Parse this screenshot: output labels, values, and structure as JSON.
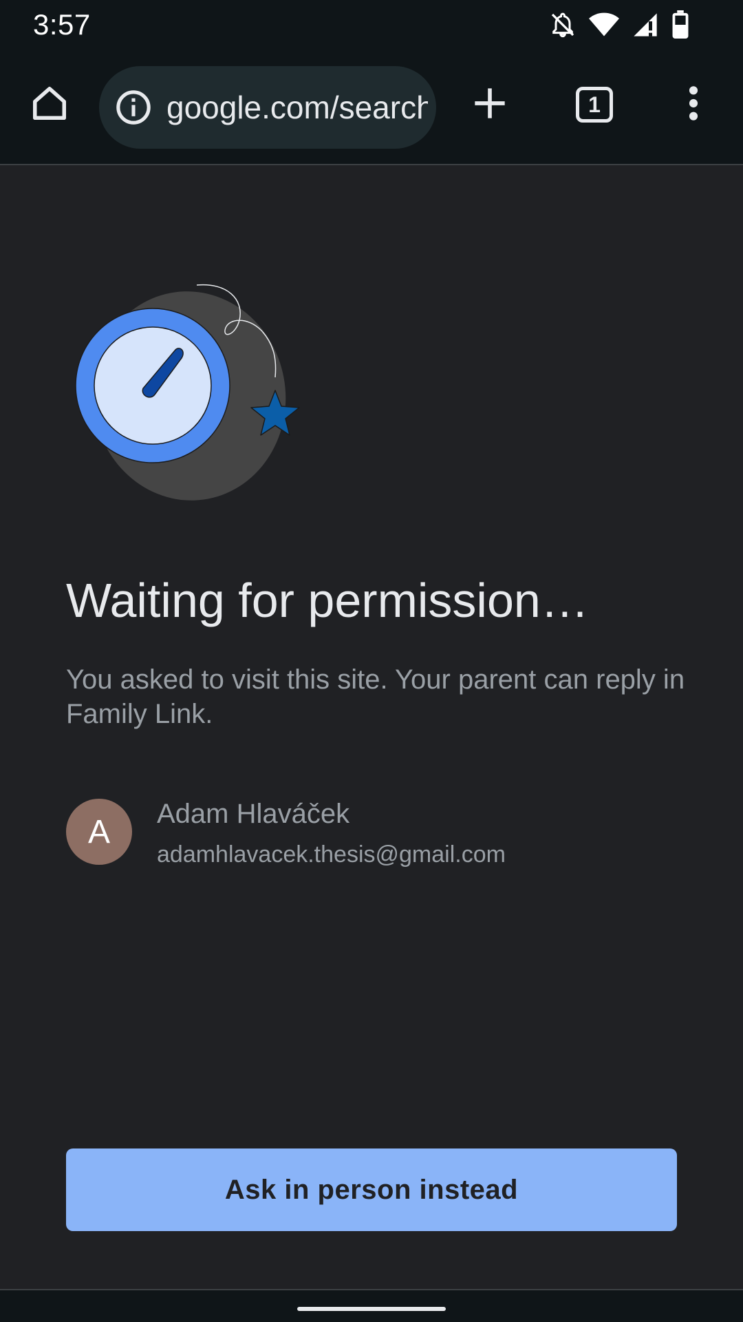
{
  "status_bar": {
    "time": "3:57",
    "icons": [
      "notifications-off-icon",
      "wifi-icon",
      "signal-icon",
      "battery-icon"
    ]
  },
  "toolbar": {
    "url": "google.com/search",
    "tab_count": "1",
    "icons": [
      "home-icon",
      "info-icon",
      "plus-icon",
      "tabs-icon",
      "more-vert-icon"
    ]
  },
  "page": {
    "title": "Waiting for permission…",
    "subtitle": "You asked to visit this site. Your parent can reply in Family Link.",
    "account": {
      "avatar_letter": "A",
      "name": "Adam Hlaváček",
      "email": "adamhlavacek.thesis@gmail.com"
    },
    "ask_button": "Ask in person instead"
  },
  "colors": {
    "background": "#202124",
    "toolbar": "#0f1518",
    "omnibox": "#1f2b2f",
    "button": "#8ab4f8",
    "avatar": "#8d6e63",
    "clock_ring": "#4f8bf0",
    "star": "#0b5ea8"
  }
}
